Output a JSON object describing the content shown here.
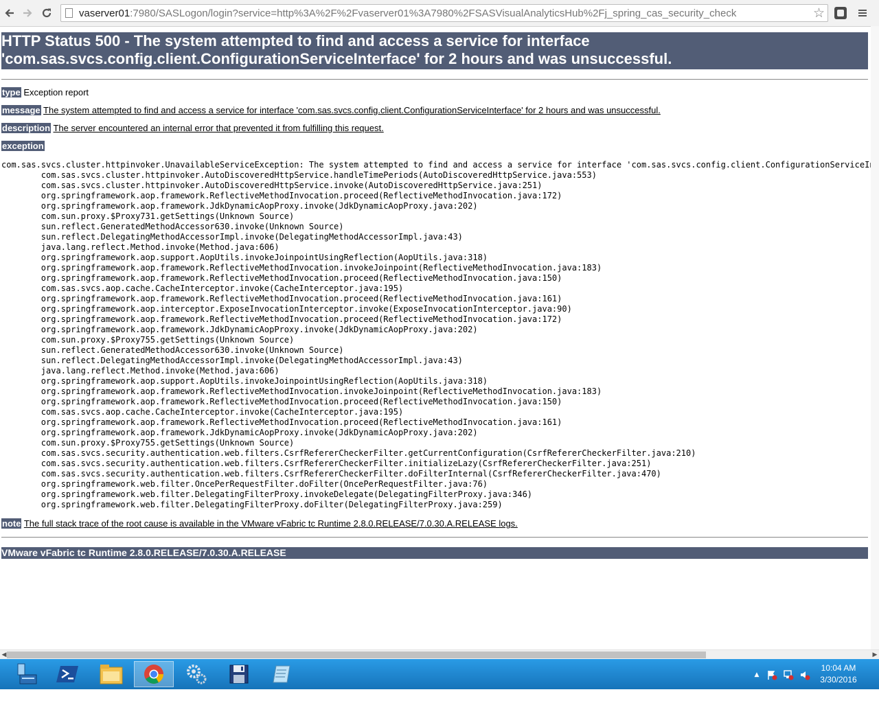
{
  "browser": {
    "back_icon": "back-arrow-icon",
    "forward_icon": "forward-arrow-icon",
    "reload_icon": "reload-icon",
    "url_host": "vaserver01",
    "url_rest": ":7980/SASLogon/login?service=http%3A%2F%2Fvaserver01%3A7980%2FSASVisualAnalyticsHub%2Fj_spring_cas_security_check",
    "star_icon": "bookmark-star-icon",
    "extension_icon": "extension-icon",
    "menu_icon": "menu-icon"
  },
  "error": {
    "title_line1": "HTTP Status 500 - The system attempted to find and access a service for interface",
    "title_line2": "'com.sas.svcs.config.client.ConfigurationServiceInterface' for 2 hours and was unsuccessful.",
    "type_key": "type",
    "type_value": "Exception report",
    "message_key": "message",
    "message_value": "The system attempted to find and access a service for interface 'com.sas.svcs.config.client.ConfigurationServiceInterface' for 2 hours and was unsuccessful.",
    "description_key": "description",
    "description_value": "The server encountered an internal error that prevented it from fulfilling this request.",
    "exception_key": "exception",
    "trace_head": "com.sas.svcs.cluster.httpinvoker.UnavailableServiceException: The system attempted to find and access a service for interface 'com.sas.svcs.config.client.ConfigurationServiceInte",
    "trace_lines": [
      "com.sas.svcs.cluster.httpinvoker.AutoDiscoveredHttpService.handleTimePeriods(AutoDiscoveredHttpService.java:553)",
      "com.sas.svcs.cluster.httpinvoker.AutoDiscoveredHttpService.invoke(AutoDiscoveredHttpService.java:251)",
      "org.springframework.aop.framework.ReflectiveMethodInvocation.proceed(ReflectiveMethodInvocation.java:172)",
      "org.springframework.aop.framework.JdkDynamicAopProxy.invoke(JdkDynamicAopProxy.java:202)",
      "com.sun.proxy.$Proxy731.getSettings(Unknown Source)",
      "sun.reflect.GeneratedMethodAccessor630.invoke(Unknown Source)",
      "sun.reflect.DelegatingMethodAccessorImpl.invoke(DelegatingMethodAccessorImpl.java:43)",
      "java.lang.reflect.Method.invoke(Method.java:606)",
      "org.springframework.aop.support.AopUtils.invokeJoinpointUsingReflection(AopUtils.java:318)",
      "org.springframework.aop.framework.ReflectiveMethodInvocation.invokeJoinpoint(ReflectiveMethodInvocation.java:183)",
      "org.springframework.aop.framework.ReflectiveMethodInvocation.proceed(ReflectiveMethodInvocation.java:150)",
      "com.sas.svcs.aop.cache.CacheInterceptor.invoke(CacheInterceptor.java:195)",
      "org.springframework.aop.framework.ReflectiveMethodInvocation.proceed(ReflectiveMethodInvocation.java:161)",
      "org.springframework.aop.interceptor.ExposeInvocationInterceptor.invoke(ExposeInvocationInterceptor.java:90)",
      "org.springframework.aop.framework.ReflectiveMethodInvocation.proceed(ReflectiveMethodInvocation.java:172)",
      "org.springframework.aop.framework.JdkDynamicAopProxy.invoke(JdkDynamicAopProxy.java:202)",
      "com.sun.proxy.$Proxy755.getSettings(Unknown Source)",
      "sun.reflect.GeneratedMethodAccessor630.invoke(Unknown Source)",
      "sun.reflect.DelegatingMethodAccessorImpl.invoke(DelegatingMethodAccessorImpl.java:43)",
      "java.lang.reflect.Method.invoke(Method.java:606)",
      "org.springframework.aop.support.AopUtils.invokeJoinpointUsingReflection(AopUtils.java:318)",
      "org.springframework.aop.framework.ReflectiveMethodInvocation.invokeJoinpoint(ReflectiveMethodInvocation.java:183)",
      "org.springframework.aop.framework.ReflectiveMethodInvocation.proceed(ReflectiveMethodInvocation.java:150)",
      "com.sas.svcs.aop.cache.CacheInterceptor.invoke(CacheInterceptor.java:195)",
      "org.springframework.aop.framework.ReflectiveMethodInvocation.proceed(ReflectiveMethodInvocation.java:161)",
      "org.springframework.aop.framework.JdkDynamicAopProxy.invoke(JdkDynamicAopProxy.java:202)",
      "com.sun.proxy.$Proxy755.getSettings(Unknown Source)",
      "com.sas.svcs.security.authentication.web.filters.CsrfRefererCheckerFilter.getCurrentConfiguration(CsrfRefererCheckerFilter.java:210)",
      "com.sas.svcs.security.authentication.web.filters.CsrfRefererCheckerFilter.initializeLazy(CsrfRefererCheckerFilter.java:251)",
      "com.sas.svcs.security.authentication.web.filters.CsrfRefererCheckerFilter.doFilterInternal(CsrfRefererCheckerFilter.java:470)",
      "org.springframework.web.filter.OncePerRequestFilter.doFilter(OncePerRequestFilter.java:76)",
      "org.springframework.web.filter.DelegatingFilterProxy.invokeDelegate(DelegatingFilterProxy.java:346)",
      "org.springframework.web.filter.DelegatingFilterProxy.doFilter(DelegatingFilterProxy.java:259)"
    ],
    "note_key": "note",
    "note_value": "The full stack trace of the root cause is available in the VMware vFabric tc Runtime 2.8.0.RELEASE/7.0.30.A.RELEASE logs.",
    "server_footer": "VMware vFabric tc Runtime 2.8.0.RELEASE/7.0.30.A.RELEASE"
  },
  "taskbar": {
    "apps": [
      "server-manager-icon",
      "powershell-icon",
      "file-explorer-icon",
      "chrome-icon",
      "settings-gears-icon",
      "floppy-save-icon",
      "notepad-icon"
    ],
    "tray_icons": [
      "show-hidden-icons-arrow",
      "flag-alert-icon",
      "network-alert-icon",
      "volume-muted-icon"
    ],
    "clock_time": "10:04 AM",
    "clock_date": "3/30/2016"
  },
  "colors": {
    "tomcat_header": "#525D76",
    "taskbar": "#1f88d3"
  }
}
